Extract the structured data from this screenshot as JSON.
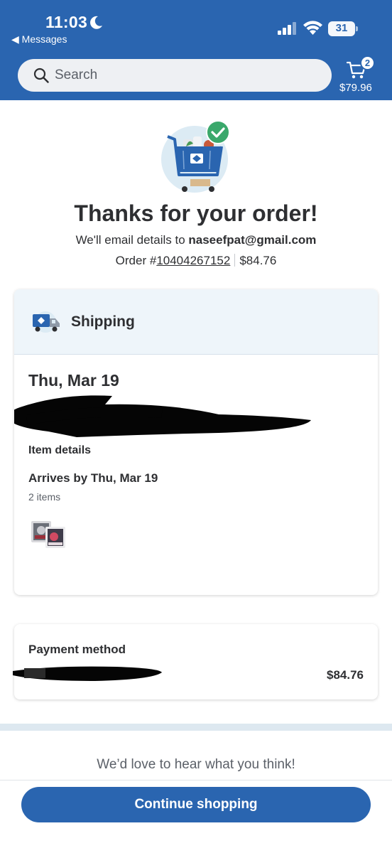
{
  "status_bar": {
    "time": "11:03",
    "back_app": "◀ Messages",
    "battery": "31"
  },
  "header": {
    "search_placeholder": "Search",
    "cart_count": "2",
    "cart_total": "$79.96"
  },
  "confirmation": {
    "title": "Thanks for your order!",
    "email_prefix": "We'll email details to ",
    "email": "naseefpat@gmail.com",
    "order_prefix": "Order #",
    "order_number": "10404267152",
    "order_total": "$84.76"
  },
  "shipping": {
    "title": "Shipping",
    "date": "Thu, Mar 19",
    "item_details_label": "Item details",
    "arrives": "Arrives by Thu, Mar 19",
    "items_count": "2 items"
  },
  "payment": {
    "title": "Payment method",
    "amount": "$84.76"
  },
  "feedback": "We’d love to hear what you think!",
  "continue_button": "Continue shopping",
  "colors": {
    "brand_blue": "#2a65b0",
    "success_green": "#3aa86b",
    "text_dark": "#2e2f32"
  }
}
